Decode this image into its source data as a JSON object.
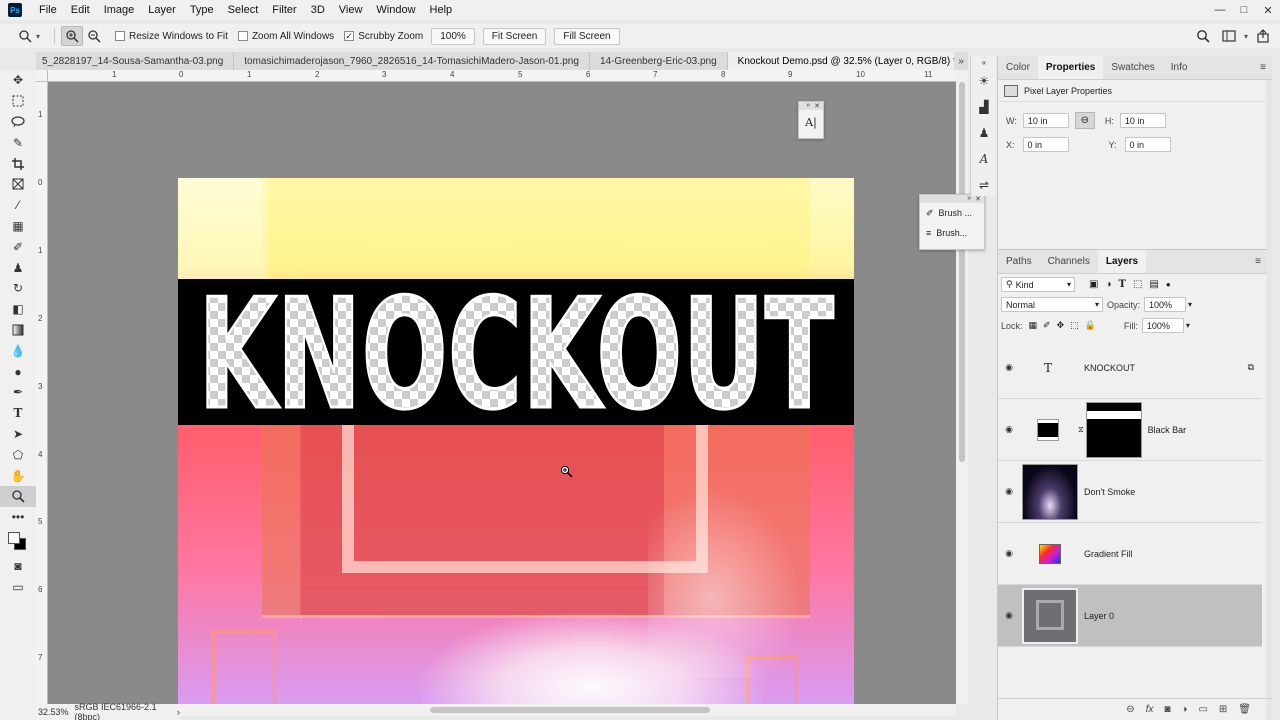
{
  "menu": [
    "File",
    "Edit",
    "Image",
    "Layer",
    "Type",
    "Select",
    "Filter",
    "3D",
    "View",
    "Window",
    "Help"
  ],
  "app_logo": "Ps",
  "window_controls": [
    "—",
    "□",
    "✕"
  ],
  "options": {
    "resize_windows_label": "Resize Windows to Fit",
    "resize_windows_checked": false,
    "zoom_all_label": "Zoom All Windows",
    "zoom_all_checked": false,
    "scrubby_label": "Scrubby Zoom",
    "scrubby_checked": true,
    "zoom_value": "100%",
    "fit_screen": "Fit Screen",
    "fill_screen": "Fill Screen"
  },
  "tabs": [
    {
      "label": "5_2828197_14-Sousa-Samantha-03.png",
      "active": false
    },
    {
      "label": "tomasichimaderojason_7960_2826516_14-TomasichiMadero-Jason-01.png",
      "active": false
    },
    {
      "label": "14-Greenberg-Eric-03.png",
      "active": false
    },
    {
      "label": "Knockout Demo.psd @ 32.5% (Layer 0, RGB/8) *",
      "active": true
    }
  ],
  "tab_close": "×",
  "tab_overflow": "»",
  "ruler_top_labels": [
    "1",
    "0",
    "1",
    "2",
    "3",
    "4",
    "5",
    "6",
    "7",
    "8",
    "9",
    "10",
    "11"
  ],
  "ruler_left_labels": [
    "1",
    "0",
    "1",
    "2",
    "3",
    "4",
    "5",
    "6",
    "7"
  ],
  "document": {
    "knockout_text": "KNOCKOUT"
  },
  "status": {
    "zoom": "32.53%",
    "profile": "sRGB IEC61966-2.1 (8bpc)",
    "arrow": "›"
  },
  "float_char_panel": {
    "icon": "A|"
  },
  "float_brush_panel": {
    "items": [
      "Brush ...",
      "Brush..."
    ]
  },
  "properties_panel": {
    "tabs": [
      "Color",
      "Properties",
      "Swatches",
      "Info"
    ],
    "active_tab": "Properties",
    "title": "Pixel Layer Properties",
    "w_label": "W:",
    "w_value": "10 in",
    "h_label": "H:",
    "h_value": "10 in",
    "x_label": "X:",
    "x_value": "0 in",
    "y_label": "Y:",
    "y_value": "0 in"
  },
  "layers_panel": {
    "tabs": [
      "Paths",
      "Channels",
      "Layers"
    ],
    "active_tab": "Layers",
    "filter_kind": "Kind",
    "blend_mode": "Normal",
    "opacity_label": "Opacity:",
    "opacity_value": "100%",
    "lock_label": "Lock:",
    "fill_label": "Fill:",
    "fill_value": "100%",
    "text_layer_glyph": "T",
    "layers": [
      {
        "name": "KNOCKOUT",
        "type": "text",
        "selected": false
      },
      {
        "name": "Black Bar",
        "type": "mask",
        "selected": false
      },
      {
        "name": "Don't Smoke",
        "type": "image",
        "selected": false
      },
      {
        "name": "Gradient Fill",
        "type": "gradient",
        "selected": false
      },
      {
        "name": "Layer 0",
        "type": "image",
        "selected": true
      }
    ]
  },
  "colors": {
    "chrome": "#f0f0f0",
    "canvas_bg": "#8a8a8a",
    "selected_layer": "#c0c0c0"
  }
}
